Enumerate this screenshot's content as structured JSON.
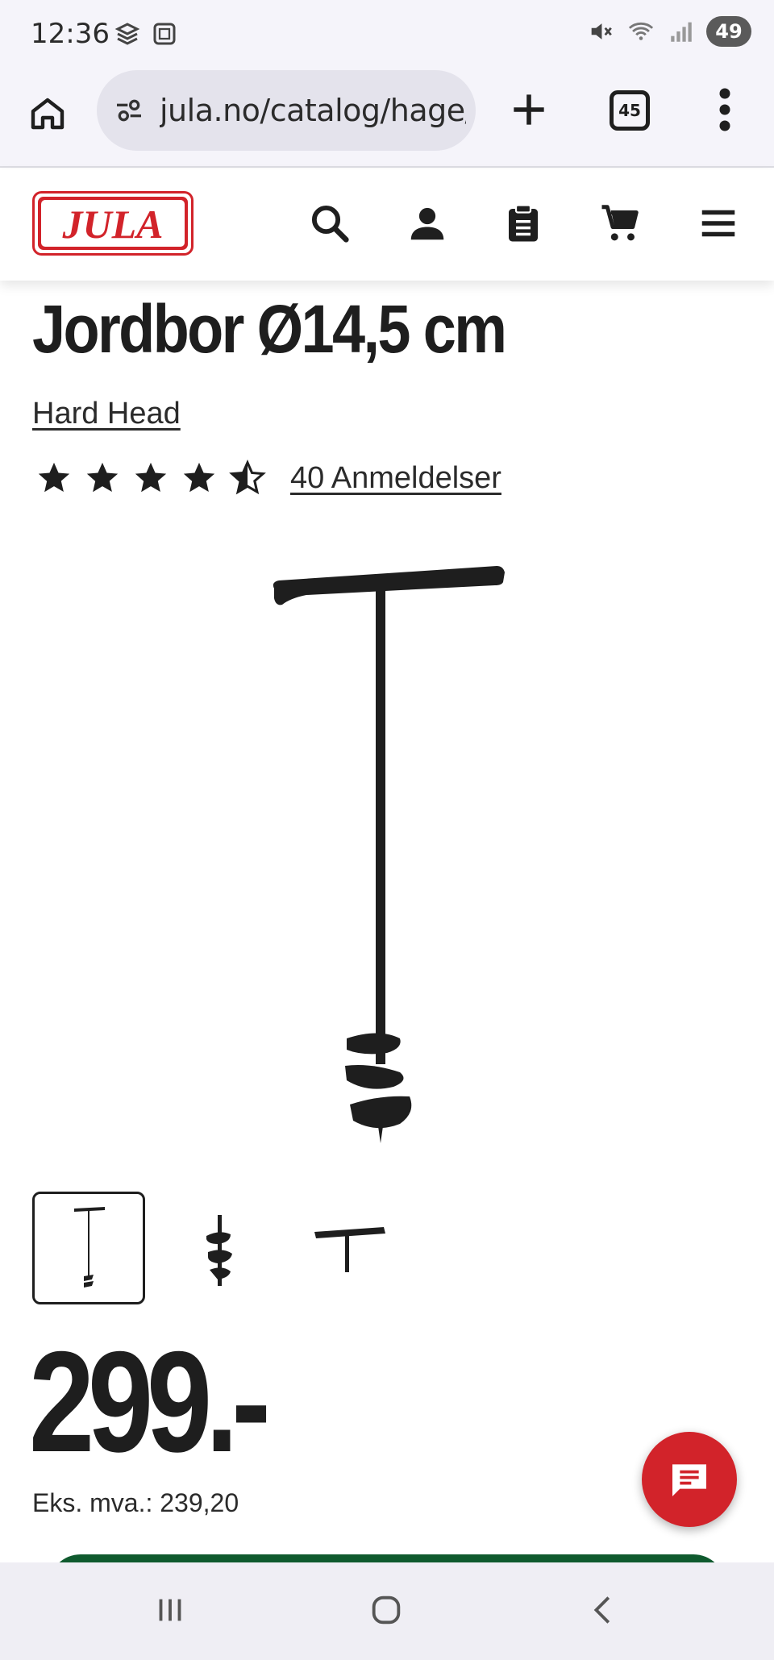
{
  "status_bar": {
    "time": "12:36",
    "battery": "49",
    "icons": [
      "gallery-icon",
      "screenshot-icon",
      "mute-icon",
      "wifi-icon",
      "signal-icon"
    ]
  },
  "browser": {
    "url": "jula.no/catalog/hage/",
    "tab_count": "45",
    "icons": [
      "home-icon",
      "site-settings-icon",
      "new-tab-icon",
      "tabs-icon",
      "more-menu-icon"
    ]
  },
  "header": {
    "logo_text": "JULA",
    "icons": [
      "search-icon",
      "account-icon",
      "shopping-list-icon",
      "cart-icon",
      "hamburger-menu-icon"
    ],
    "brand_color": "#d2232a"
  },
  "product": {
    "title": "Jordbor Ø14,5 cm",
    "brand": "Hard Head",
    "rating": 4.5,
    "rating_max": 5,
    "reviews_label": "40 Anmeldelser",
    "thumbnails": [
      "full-view",
      "auger-detail",
      "handle-detail"
    ],
    "active_thumbnail": 0,
    "price": "299.-",
    "ex_vat_label": "Eks. mva.: 239,20"
  },
  "chat": {
    "icon": "chat-icon",
    "color": "#d2232a"
  },
  "add_to_cart_color": "#0f5a2e",
  "nav_bar": {
    "icons": [
      "recent-apps-icon",
      "home-nav-icon",
      "back-icon"
    ]
  }
}
